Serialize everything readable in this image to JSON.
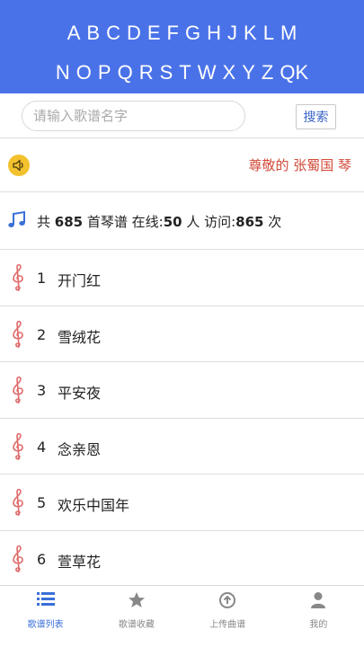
{
  "alphabet": {
    "row1": [
      "A",
      "B",
      "C",
      "D",
      "E",
      "F",
      "G",
      "H",
      "J",
      "K",
      "L",
      "M"
    ],
    "row2": [
      "N",
      "O",
      "P",
      "Q",
      "R",
      "S",
      "T",
      "W",
      "X",
      "Y",
      "Z",
      "QK"
    ]
  },
  "search": {
    "placeholder": "请输入歌谱名字",
    "button_label": "搜索"
  },
  "notice": {
    "text": "尊敬的 张蜀国 琴"
  },
  "stats": {
    "prefix": "共 ",
    "score_count": "685",
    "score_unit": " 首琴谱 在线:",
    "online_count": "50",
    "online_unit": " 人 访问:",
    "visit_count": "865",
    "visit_unit": " 次"
  },
  "songs": [
    {
      "num": "1",
      "title": "开门红"
    },
    {
      "num": "2",
      "title": "雪绒花"
    },
    {
      "num": "3",
      "title": "平安夜"
    },
    {
      "num": "4",
      "title": "念亲恩"
    },
    {
      "num": "5",
      "title": "欢乐中国年"
    },
    {
      "num": "6",
      "title": "萱草花"
    }
  ],
  "tabs": [
    {
      "label": "歌谱列表",
      "icon": "list-icon",
      "active": true
    },
    {
      "label": "歌谱收藏",
      "icon": "star-icon",
      "active": false
    },
    {
      "label": "上传曲谱",
      "icon": "upload-icon",
      "active": false
    },
    {
      "label": "我的",
      "icon": "user-icon",
      "active": false
    }
  ],
  "colors": {
    "header_blue": "#4a72e8",
    "notice_red": "#d24a3a",
    "active_tab": "#3a6fd8",
    "clef_red": "#e06a6a",
    "speaker_yellow": "#f2c12e"
  }
}
